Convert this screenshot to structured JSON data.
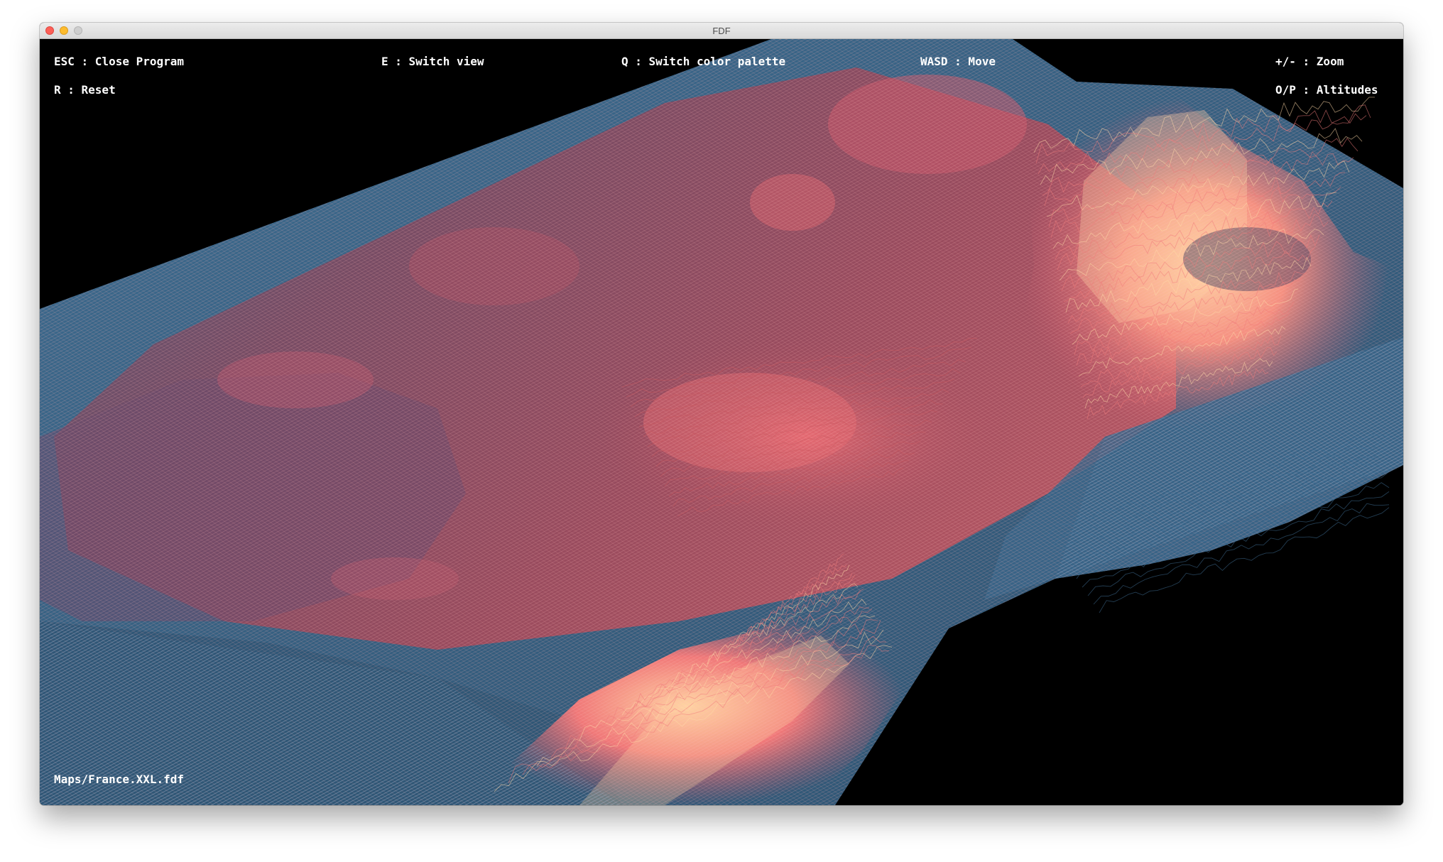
{
  "window": {
    "title": "FDF"
  },
  "controls": {
    "close_program": "ESC : Close Program",
    "switch_view": "E : Switch view",
    "switch_palette": "Q : Switch color palette",
    "move": "WASD : Move",
    "zoom": "+/- : Zoom",
    "reset": "R : Reset",
    "altitudes": "O/P : Altitudes"
  },
  "map": {
    "file": "Maps/France.XXL.fdf"
  },
  "palette": {
    "low": "#3f6f95",
    "mid": "#c8575f",
    "high": "#f07b7b",
    "peak": "#ffd9a8",
    "background": "#000000"
  },
  "icons": {
    "close": "close-dot-icon",
    "minimize": "minimize-dot-icon",
    "maximize": "maximize-dot-icon"
  }
}
